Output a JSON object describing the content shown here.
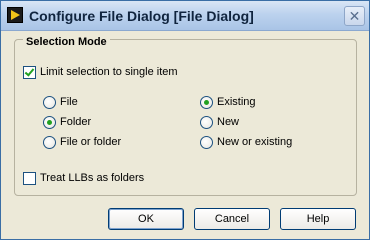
{
  "window": {
    "title": "Configure File Dialog [File Dialog]",
    "close_glyph": "✕"
  },
  "group": {
    "title": "Selection Mode"
  },
  "limit_single": {
    "label": "Limit selection to single item",
    "checked": true
  },
  "type_options": [
    {
      "label": "File",
      "selected": false
    },
    {
      "label": "Folder",
      "selected": true
    },
    {
      "label": "File or folder",
      "selected": false
    }
  ],
  "existence_options": [
    {
      "label": "Existing",
      "selected": true
    },
    {
      "label": "New",
      "selected": false
    },
    {
      "label": "New or existing",
      "selected": false
    }
  ],
  "treat_llbs": {
    "label": "Treat LLBs as folders",
    "checked": false
  },
  "buttons": {
    "ok": "OK",
    "cancel": "Cancel",
    "help": "Help"
  },
  "colors": {
    "accent": "#21a121",
    "titlebar": "#bcd2ee",
    "border": "#003c74"
  }
}
